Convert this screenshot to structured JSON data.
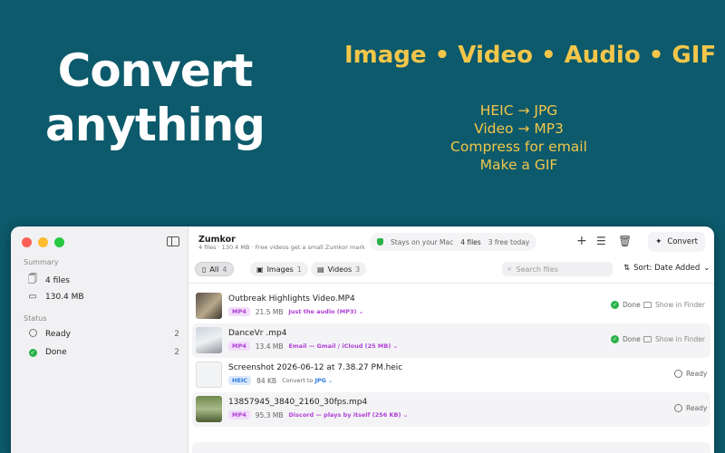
{
  "hero": {
    "line1": "Convert",
    "line2": "anything"
  },
  "formats": "Image • Video • Audio • GIF",
  "examples": [
    "HEIC → JPG",
    "Video → MP3",
    "Compress for email",
    "Make a GIF"
  ],
  "colors": {
    "background": "#0c5a6b",
    "accent_yellow": "#f3c64a",
    "done_green": "#2ab24a",
    "purple": "#b03fd6",
    "blue": "#2a7be0"
  },
  "sidebar": {
    "summary_label": "Summary",
    "files": "4 files",
    "size": "130.4 MB",
    "status_label": "Status",
    "ready": {
      "label": "Ready",
      "count": "2"
    },
    "done": {
      "label": "Done",
      "count": "2"
    }
  },
  "toolbar": {
    "app_name": "Zumkor",
    "subtitle": "4 files · 130.4 MB · Free videos get a small Zumkor mark",
    "privacy": "Stays on your Mac",
    "file_count": "4 files",
    "free_today": "3 free today",
    "convert_label": "Convert",
    "icons": [
      "plus-icon",
      "sliders-icon",
      "trash-icon",
      "wand-icon"
    ]
  },
  "filters": [
    {
      "label": "All",
      "count": "4",
      "icon": "doc-icon"
    },
    {
      "label": "Images",
      "count": "1",
      "icon": "photo-icon"
    },
    {
      "label": "Videos",
      "count": "3",
      "icon": "film-icon"
    }
  ],
  "search_placeholder": "Search files",
  "sort_label": "Sort: Date Added",
  "files": [
    {
      "name": "Outbreak Highlights Video.MP4",
      "type": "MP4",
      "size": "21.5 MB",
      "preset": "Just the audio (MP3)",
      "status": "Done",
      "finder": "Show in Finder"
    },
    {
      "name": "DanceVr .mp4",
      "type": "MP4",
      "size": "13.4 MB",
      "preset": "Email — Gmail / iCloud (25 MB)",
      "status": "Done",
      "finder": "Show in Finder"
    },
    {
      "name": "Screenshot 2026-06-12 at 7.38.27 PM.heic",
      "type": "HEIC",
      "size": "84 KB",
      "convert_to": "Convert to",
      "preset": "JPG",
      "status": "Ready"
    },
    {
      "name": "13857945_3840_2160_30fps.mp4",
      "type": "MP4",
      "size": "95.3 MB",
      "preset": "Discord — plays by itself (256 KB)",
      "status": "Ready"
    }
  ]
}
